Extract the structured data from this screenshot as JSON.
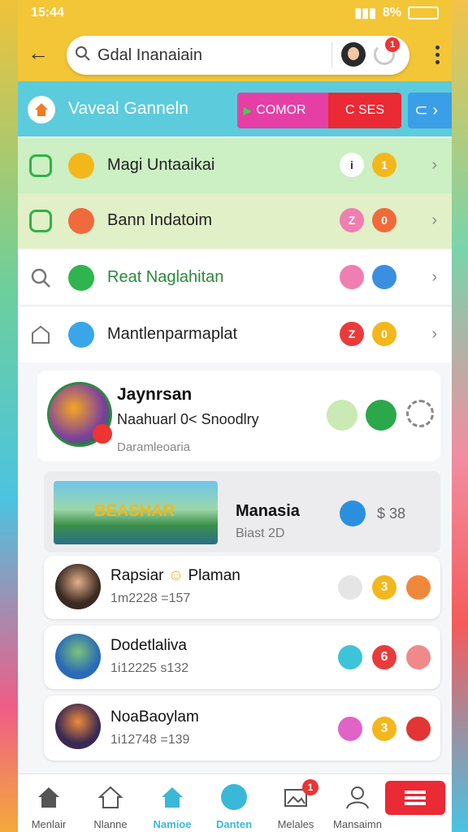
{
  "status": {
    "time": "15:44",
    "battery": "8%"
  },
  "header": {
    "search_value": "Gdal Inanaiain",
    "notification_count": "1"
  },
  "banner": {
    "title": "Vaveal Ganneln",
    "btn_primary": "COMOR",
    "btn_secondary": "C SES"
  },
  "menu": [
    {
      "label": "Magi Untaaikai",
      "c1": "i",
      "c2": "1",
      "lead_color": "#31b14a",
      "icon_color": "#f3b71c",
      "c1_color": "#ffffff",
      "c2_color": "#f3b71c",
      "bg": "#ccefc3"
    },
    {
      "label": "Bann Indatoim",
      "c1": "Z",
      "c2": "0",
      "lead_color": "#31b14a",
      "icon_color": "#f06a3c",
      "c1_color": "#ef7fb0",
      "c2_color": "#f06a3c",
      "bg": "#dff0c6"
    },
    {
      "label": "Reat Naglahitan",
      "c1": "",
      "c2": "",
      "lead_color": "#777777",
      "icon_color": "#2fb54e",
      "c1_color": "#ef7fb0",
      "c2_color": "#3b8fe0",
      "bg": "#ffffff",
      "label_color": "#2a8a3a"
    },
    {
      "label": "Mantlenparmaplat",
      "c1": "Z",
      "c2": "0",
      "lead_color": "#777777",
      "icon_color": "#3aa6e9",
      "c1_color": "#ea3b3b",
      "c2_color": "#f3b71c",
      "bg": "#ffffff"
    }
  ],
  "profile": {
    "name": "Jaynrsan",
    "subtitle": "Naahuarl 0< Snoodlry",
    "meta": "Daramleoaria"
  },
  "featured": {
    "banner_text": "BEASHAR",
    "title": "Manasia",
    "sub": "Biast 2D",
    "price": "$ 38"
  },
  "games": [
    {
      "name": "Rapsiar",
      "name2": "Plaman",
      "sub": "1m2228 =157",
      "c2": "3",
      "c1_color": "#e5e5e5",
      "c2_color": "#f3b71c",
      "c3_color": "#f0883c"
    },
    {
      "name": "Dodetlaliva",
      "name2": "",
      "sub": "1i12225 s132",
      "c2": "6",
      "c1_color": "#3dc4d8",
      "c2_color": "#ea3b3b",
      "c3_color": "#f08a8a"
    },
    {
      "name": "NoaBaoylam",
      "name2": "",
      "sub": "1i12748 =139",
      "c2": "3",
      "c1_color": "#e064c8",
      "c2_color": "#f3b71c",
      "c3_color": "#e43535"
    }
  ],
  "nav": [
    {
      "label": "Menlair"
    },
    {
      "label": "Nlanne"
    },
    {
      "label": "Namioe"
    },
    {
      "label": "Danten"
    },
    {
      "label": "Melales",
      "badge": "1"
    },
    {
      "label": "Mansaimn"
    }
  ]
}
